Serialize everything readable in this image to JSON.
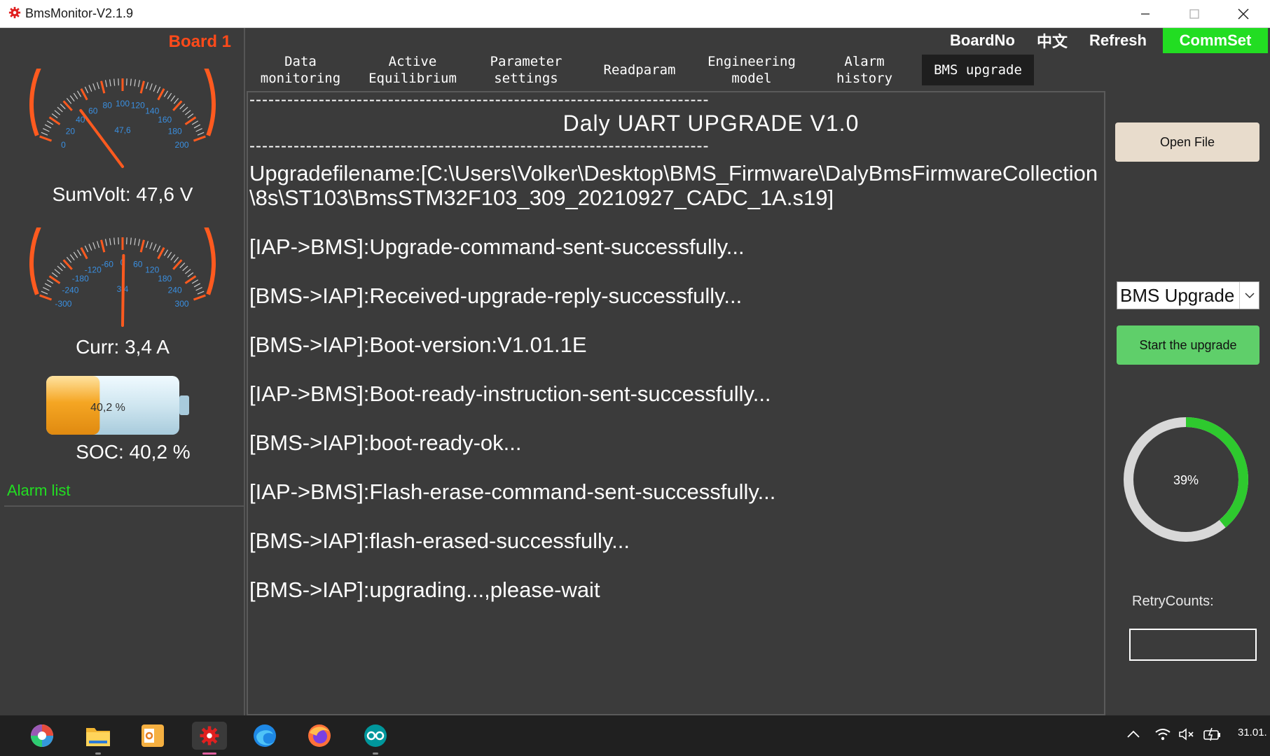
{
  "window": {
    "title": "BmsMonitor-V2.1.9"
  },
  "board": {
    "label": "Board 1"
  },
  "gauges": {
    "voltage": {
      "label": "SumVolt: 47,6 V",
      "readout": "47,6",
      "value": 47.6,
      "min": 0,
      "max": 200,
      "ticks": [
        "0",
        "20",
        "40",
        "60",
        "80",
        "100",
        "120",
        "140",
        "160",
        "180",
        "200"
      ]
    },
    "current": {
      "label": "Curr: 3,4 A",
      "readout": "3,4",
      "value": 3.4,
      "min": -300,
      "max": 300,
      "ticks": [
        "-300",
        "-240",
        "-180",
        "-120",
        "-60",
        "0",
        "60",
        "120",
        "180",
        "240",
        "300"
      ]
    }
  },
  "battery": {
    "percent_text": "40,2 %",
    "fill": 0.402,
    "soc_label": "SOC: 40,2 %"
  },
  "alarm": {
    "title": "Alarm list"
  },
  "topmenu": {
    "boardno": "BoardNo",
    "chinese": "中文",
    "refresh": "Refresh",
    "commset": "CommSet"
  },
  "tabs": [
    {
      "line1": "Data",
      "line2": "monitoring"
    },
    {
      "line1": "Active",
      "line2": "Equilibrium"
    },
    {
      "line1": "Parameter",
      "line2": "settings"
    },
    {
      "line1": "Readparam",
      "line2": ""
    },
    {
      "line1": "Engineering",
      "line2": "model"
    },
    {
      "line1": "Alarm history",
      "line2": ""
    },
    {
      "line1": "BMS upgrade",
      "line2": ""
    }
  ],
  "log": {
    "dashes": "-------------------------------------------------------------------------",
    "title": "Daly UART UPGRADE V1.0",
    "filename": "Upgradefilename:[C:\\Users\\Volker\\Desktop\\BMS_Firmware\\DalyBmsFirmwareCollection\\8s\\ST103\\BmsSTM32F103_309_20210927_CADC_1A.s19]",
    "entries": [
      "[IAP->BMS]:Upgrade-command-sent-successfully...",
      "[BMS->IAP]:Received-upgrade-reply-successfully...",
      "[BMS->IAP]:Boot-version:V1.01.1E",
      "[IAP->BMS]:Boot-ready-instruction-sent-successfully...",
      "[BMS->IAP]:boot-ready-ok...",
      "[IAP->BMS]:Flash-erase-command-sent-successfully...",
      "[BMS->IAP]:flash-erased-successfully...",
      "[BMS->IAP]:upgrading...,please-wait"
    ]
  },
  "right": {
    "open_file": "Open File",
    "mode_select": "BMS Upgrade",
    "start_button": "Start the upgrade",
    "progress_text": "39%",
    "progress_value": 0.39,
    "retry_label": "RetryCounts:",
    "retry_value": ""
  },
  "taskbar": {
    "clock": "31.01."
  },
  "colors": {
    "accent_green": "#22dd22",
    "board_red": "#ff4a1a",
    "gauge_orange": "#ff5a1f",
    "gauge_blue": "#3a8fe0",
    "progress_green": "#2ec92e"
  }
}
